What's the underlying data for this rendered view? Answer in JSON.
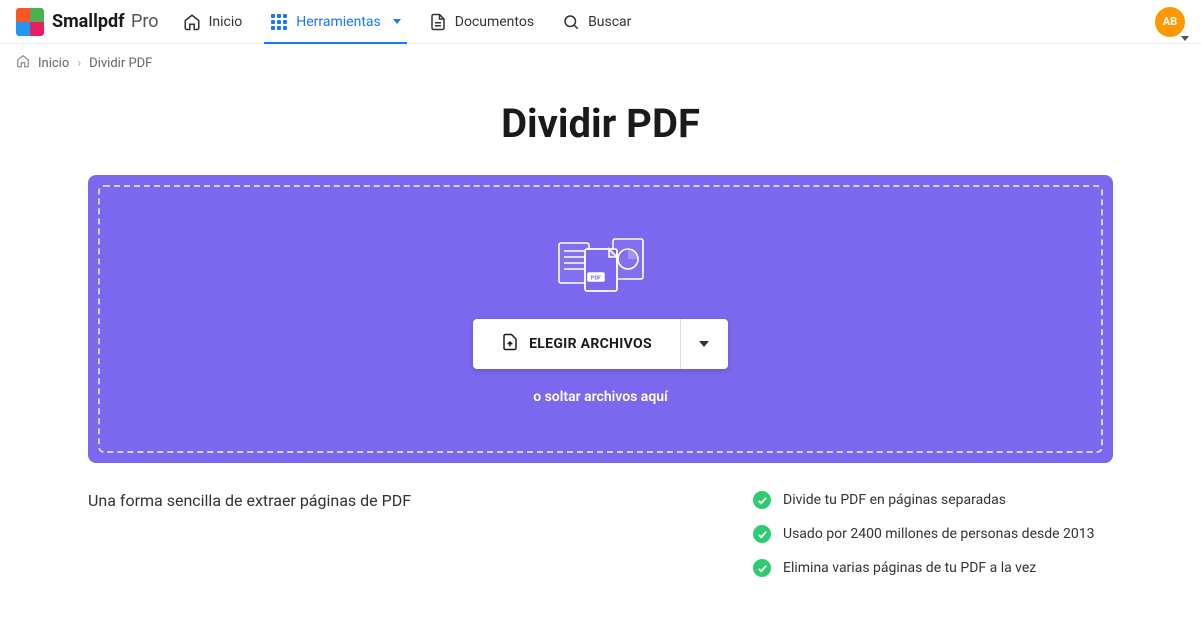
{
  "header": {
    "brand_main": "Smallpdf",
    "brand_pro": "Pro",
    "nav": {
      "home": "Inicio",
      "tools": "Herramientas",
      "documents": "Documentos",
      "search": "Buscar"
    },
    "avatar_initials": "AB"
  },
  "breadcrumb": {
    "home": "Inicio",
    "current": "Dividir PDF"
  },
  "page": {
    "title": "Dividir PDF",
    "choose_button": "ELEGIR ARCHIVOS",
    "drop_hint": "o soltar archivos aquí",
    "subtitle": "Una forma sencilla de extraer páginas de PDF",
    "features": [
      "Divide tu PDF en páginas separadas",
      "Usado por 2400 millones de personas desde 2013",
      "Elimina varias páginas de tu PDF a la vez"
    ]
  }
}
